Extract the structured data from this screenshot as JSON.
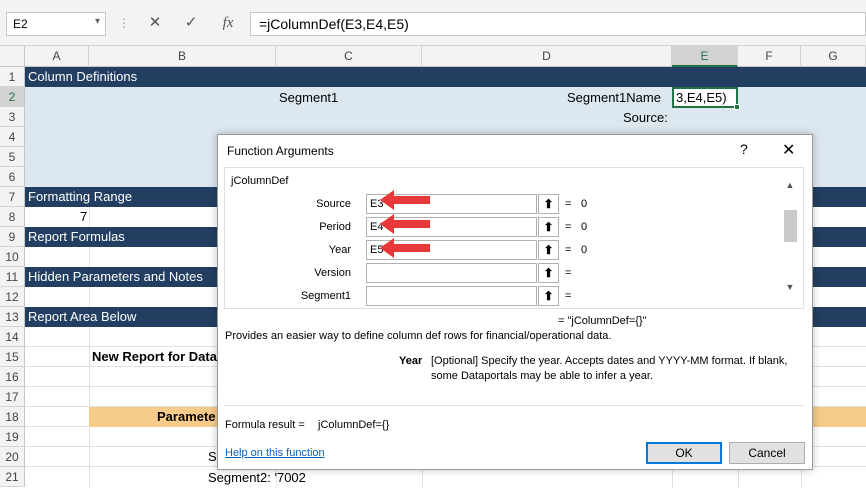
{
  "formula_bar": {
    "name_box": "E2",
    "cancel_icon": "✕",
    "enter_icon": "✓",
    "fx_icon": "fx",
    "formula": "=jColumnDef(E3,E4,E5)"
  },
  "columns": [
    "A",
    "B",
    "C",
    "D",
    "E",
    "F",
    "G"
  ],
  "rows": [
    "1",
    "2",
    "3",
    "4",
    "5",
    "6",
    "7",
    "8",
    "9",
    "10",
    "11",
    "12",
    "13",
    "14",
    "15",
    "16",
    "17",
    "18",
    "19",
    "20",
    "21"
  ],
  "sheet": {
    "r1": "Column Definitions",
    "r2_c": "Segment1",
    "r2_d": "Segment1Name",
    "r2_e": "3,E4,E5)",
    "r3_d": "Source:",
    "r7": "Formatting Range",
    "r8_b": "7",
    "r9": "Report Formulas",
    "r11": "Hidden Parameters and Notes",
    "r13": "Report Area Below",
    "r15_b": "New Report for Data",
    "r18_b": "Paramete",
    "r20_c": "Se",
    "r21_c": "Segment2: '7002"
  },
  "dialog": {
    "title": "Function Arguments",
    "help": "?",
    "close": "✕",
    "function_name": "jColumnDef",
    "args": [
      {
        "label": "Source",
        "value": "E3",
        "result": "0"
      },
      {
        "label": "Period",
        "value": "E4",
        "result": "0"
      },
      {
        "label": "Year",
        "value": "E5",
        "result": "0"
      },
      {
        "label": "Version",
        "value": "",
        "result": ""
      },
      {
        "label": "Segment1",
        "value": "",
        "result": ""
      }
    ],
    "ref_icon": "⬆",
    "equals": "=",
    "overall_result": "= \"jColumnDef={}\"",
    "description": "Provides an easier way to define column def rows for financial/operational data.",
    "arg_help_name": "Year",
    "arg_help_text_1": "[Optional]  Specify the year.  Accepts dates and YYYY-MM format. If blank,",
    "arg_help_text_2": "some Dataportals may be able to infer a year.",
    "formula_result_label": "Formula result =",
    "formula_result_value": "jColumnDef={}",
    "help_link": "Help on this function",
    "ok": "OK",
    "cancel": "Cancel"
  },
  "colors": {
    "header_band": "#223f61",
    "light_band": "#dde7f0",
    "orange_band": "#f7cb8a",
    "selection": "#217346",
    "arrow": "#e8393a"
  }
}
